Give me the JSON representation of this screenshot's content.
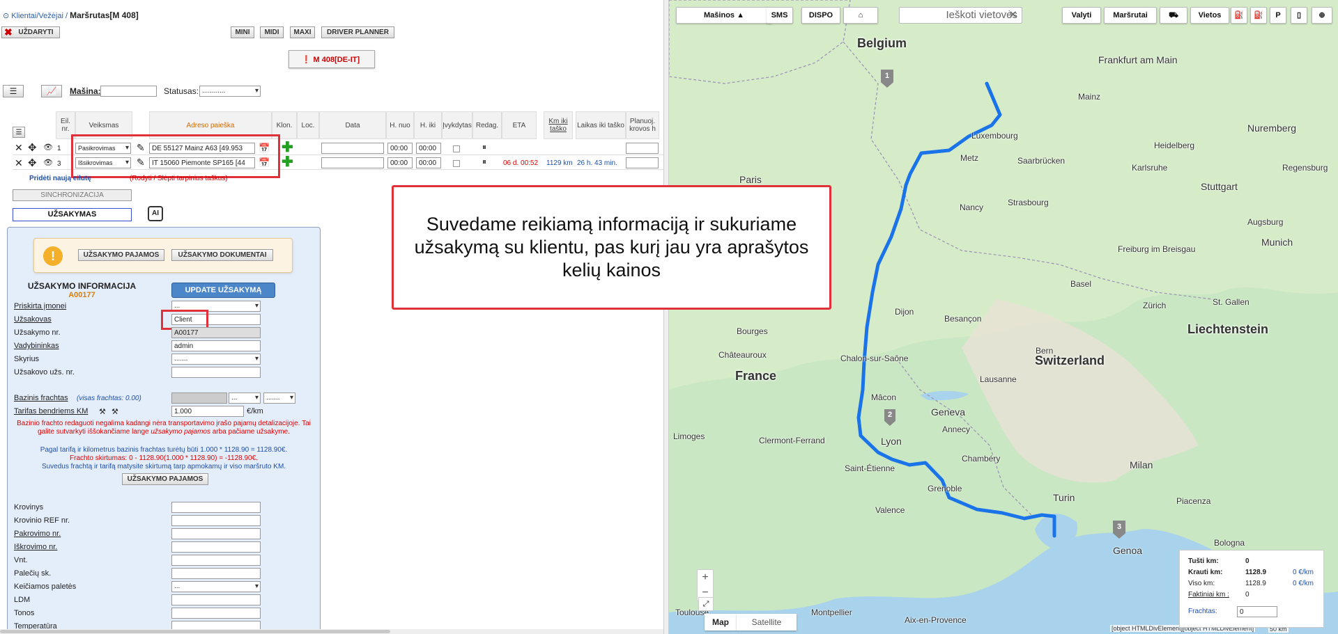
{
  "breadcrumb": {
    "parent": "Klientai/Vežėjai",
    "separator": "/",
    "title": "Maršrutas[M 408]"
  },
  "toolbar": {
    "close": "UŽDARYTI",
    "mini": "MINI",
    "midi": "MIDI",
    "maxi": "MAXI",
    "driver_planner": "DRIVER PLANNER"
  },
  "route_badge": "M 408[DE-IT]",
  "filters": {
    "masina_label": "Mašina:",
    "masina_value": "",
    "statusas_label": "Statusas:",
    "statusas_value": "............"
  },
  "table": {
    "headers": {
      "eil": "Eil. nr.",
      "veiksmas": "Veiksmas",
      "adreso": "Adreso paieška",
      "klon": "Klon.",
      "loc": "Loc.",
      "data": "Data",
      "hnuo": "H. nuo",
      "hiki": "H. iki",
      "ivyk": "Įvykdytas",
      "redag": "Redag.",
      "eta": "ETA",
      "km": "Km iki taško",
      "laikas": "Laikas iki taško",
      "planuoj": "Planuoj. krovos h"
    },
    "rows": [
      {
        "nr": "1",
        "action": "Pasikrovimas",
        "address": "DE 55127 Mainz A63 [49.953",
        "hnuo": "00:00",
        "hiki": "00:00",
        "eta": "",
        "km": "",
        "laikas": ""
      },
      {
        "nr": "3",
        "action": "Išsikrovimas",
        "address": "IT 15060 Piemonte SP165 [44",
        "hnuo": "00:00",
        "hiki": "00:00",
        "eta": "06 d. 00:52",
        "km": "1129 km",
        "laikas": "26 h. 43 min."
      }
    ]
  },
  "links": {
    "add_row": "Pridėti naują eilutę",
    "toggle": "(Rodyti / Slėpti tarpinius taškus)"
  },
  "sync": "SINCHRONIZACIJA",
  "order_button": "UŽSAKYMAS",
  "chip_icon": "ai-chip-icon",
  "chip_label": "AI",
  "warning": {
    "icon": "!",
    "income_btn": "UŽSAKYMO PAJAMOS",
    "docs_btn": "UŽSAKYMO DOKUMENTAI"
  },
  "order_info": {
    "title": "UŽSAKYMO INFORMACIJA",
    "code": "A00177",
    "update_btn": "UPDATE UŽSAKYMĄ",
    "fields": [
      {
        "label": "Priskirta įmonei",
        "value": "..."
      },
      {
        "label": "Užsakovas",
        "value": "Client"
      },
      {
        "label": "Užsakymo nr.",
        "value": "A00177"
      },
      {
        "label": "Vadybininkas",
        "value": "admin"
      },
      {
        "label": "Skyrius",
        "value": "......."
      },
      {
        "label": "Užsakovo užs. nr.",
        "value": ""
      }
    ],
    "bazinis_label": "Bazinis frachtas",
    "bazinis_note": "(visas frachtas: 0.00)",
    "bazinis_currency": "...",
    "bazinis_type": ".......",
    "tarifas_label": "Tarifas bendriems KM",
    "tarifas_value": "1.000",
    "tarifas_unit": "€/km",
    "note_red_1": "Bazinio frachto redaguoti negalima kadangi nėra transportavimo įrašo pajamų detalizacijoje. Tai galite sutvarkyti iššokančiame lange",
    "note_red_em": "užsakymo pajamos",
    "note_red_2": "arba pačiame užsakyme.",
    "note_blue": "Pagal tarifą ir kilometrus bazinis frachtas turėtų būti 1.000 * 1128.90 = 1128.90€.",
    "note_red_3": "Frachto skirtumas: 0 - 1128.90(1.000 * 1128.90) = -1128.90€.",
    "note_blue_2": "Suvedus frachtą ir tarifą matysite skirtumą tarp apmokamų ir viso maršruto KM.",
    "income_btn2": "UŽSAKYMO PAJAMOS",
    "cargo_fields": [
      {
        "label": "Krovinys",
        "value": ""
      },
      {
        "label": "Krovinio REF nr.",
        "value": ""
      },
      {
        "label": "Pakrovimo nr.",
        "value": ""
      },
      {
        "label": "Iškrovimo nr.",
        "value": ""
      },
      {
        "label": "Vnt.",
        "value": ""
      },
      {
        "label": "Palečių sk.",
        "value": ""
      },
      {
        "label": "Keičiamos paletės",
        "value": "..."
      },
      {
        "label": "LDM",
        "value": ""
      },
      {
        "label": "Tonos",
        "value": ""
      },
      {
        "label": "Temperatūra",
        "value": ""
      }
    ]
  },
  "callout": "Suvedame reikiamą informaciją ir sukuriame užsakymą su klientu, pas kurį jau yra aprašytos kelių kainos",
  "map": {
    "buttons": {
      "masinos": "Mašinos ▲",
      "sms": "SMS",
      "dispo": "DISPO",
      "valyti": "Valyti",
      "marsrutai": "Maršrutai",
      "vietos": "Vietos"
    },
    "search_placeholder": "Ieškoti vietovės",
    "countries": [
      "Belgium",
      "France",
      "Switzerland",
      "Liechtenstein"
    ],
    "cities": [
      "Frankfurt am Main",
      "Mainz",
      "Nuremberg",
      "Luxembourg",
      "Saarbrücken",
      "Heidelberg",
      "Karlsruhe",
      "Stuttgart",
      "Regensburg",
      "Paris",
      "Metz",
      "Nancy",
      "Strasbourg",
      "Freiburg im Breisgau",
      "Augsburg",
      "Munich",
      "Dijon",
      "Besançon",
      "Basel",
      "Zürich",
      "St. Gallen",
      "Bourges",
      "Bern",
      "Châteauroux",
      "Lausanne",
      "Geneva",
      "Chalon-sur-Saône",
      "Mâcon",
      "Annecy",
      "Limoges",
      "Clermont-Ferrand",
      "Lyon",
      "Chambéry",
      "Saint-Étienne",
      "Grenoble",
      "Milan",
      "Turin",
      "Piacenza",
      "Valence",
      "Genoa",
      "Bologna",
      "Montpellier",
      "Aix-en-Provence",
      "Toulouse"
    ],
    "markers": [
      "1",
      "2",
      "3"
    ],
    "summary": {
      "tusti_label": "Tušti km:",
      "tusti_value": "0",
      "krauti_label": "Krauti km:",
      "krauti_value": "1128.9",
      "krauti_rate": "0 €/km",
      "viso_label": "Viso km:",
      "viso_value": "1128.9",
      "viso_rate": "0 €/km",
      "fakt_label": "Faktiniai km :",
      "fakt_value": "0",
      "frachtas_label": "Frachtas:",
      "frachtas_value": "0"
    },
    "map_type": [
      "Map",
      "Satellite"
    ],
    "attribution": "[object HTMLDivElement][object HTMLDivElement]",
    "scale": "50 km"
  }
}
